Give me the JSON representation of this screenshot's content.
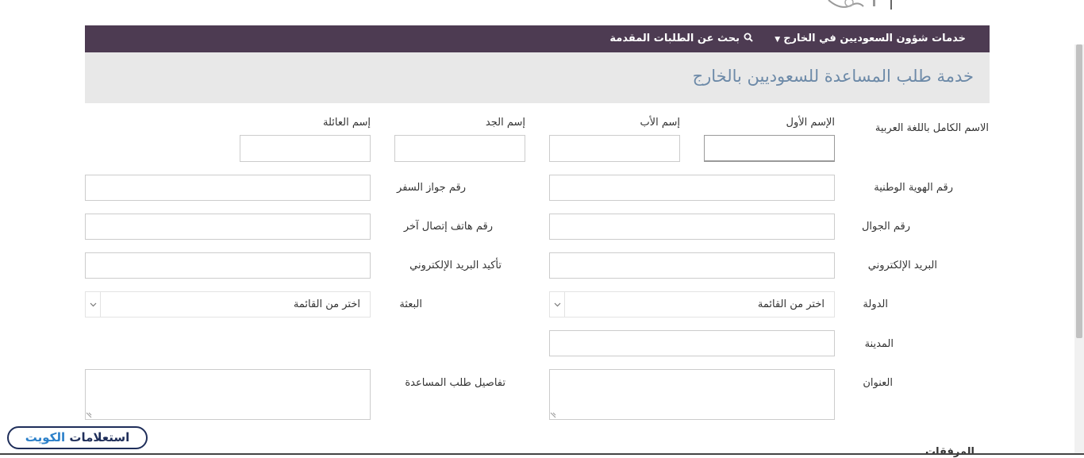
{
  "nav": {
    "services_label": "خدمات شؤون السعوديين في الخارج",
    "search_label": "بحث عن الطلبات المقدمة"
  },
  "header": {
    "title": "خدمة طلب المساعدة للسعوديين بالخارج"
  },
  "form": {
    "fullname_label": "الاسم الكامل باللغة العربية",
    "first_name_label": "الإسم الأول",
    "father_name_label": "إسم الأب",
    "grandfather_name_label": "إسم الجد",
    "family_name_label": "إسم العائلة",
    "national_id_label": "رقم الهوية الوطنية",
    "passport_label": "رقم جواز السفر",
    "mobile_label": "رقم الجوال",
    "other_phone_label": "رقم هاتف إتصال آخر",
    "email_label": "البريد الإلكتروني",
    "email_confirm_label": "تأكيد البريد الإلكتروني",
    "country_label": "الدولة",
    "country_selected": "اختر من القائمة",
    "mission_label": "البعثة",
    "mission_selected": "اختر من القائمة",
    "city_label": "المدينة",
    "address_label": "العنوان",
    "details_label": "تفاصيل طلب المساعدة",
    "values": {
      "first_name": "",
      "father_name": "",
      "grandfather_name": "",
      "family_name": "",
      "national_id": "",
      "passport": "",
      "mobile": "",
      "other_phone": "",
      "email": "",
      "email_confirm": "",
      "city": "",
      "address": "",
      "details": ""
    }
  },
  "watermark": {
    "part1": "استعلامات",
    "part2": "الكويت"
  },
  "footer": {
    "section_heading": "المرفقات"
  },
  "icons": {
    "nav_caret": "caret-down-icon",
    "nav_search": "search-icon",
    "select_arrow": "chevron-down-icon",
    "resize": "resize-grip-icon"
  },
  "colors": {
    "navbar": "#4d3b52",
    "header_band": "#e8e8e8",
    "title_text": "#6d8aa8",
    "watermark_dark": "#1f2e5a",
    "watermark_blue": "#2a7fc9"
  }
}
